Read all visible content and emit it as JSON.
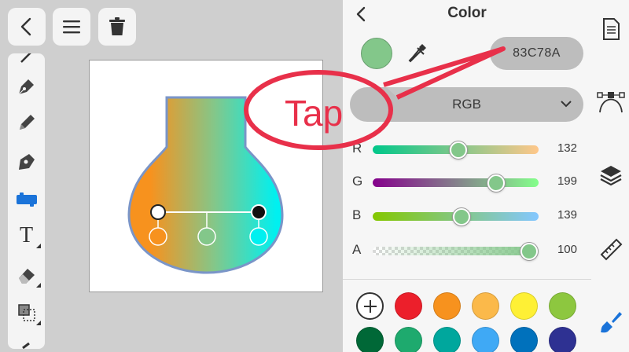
{
  "toolbar": {
    "back": "back-arrow-icon",
    "menu": "hamburger-menu-icon",
    "delete": "trash-icon"
  },
  "tools": [
    "pen-nib-icon",
    "pencil-icon",
    "shape-pen-icon",
    "ruler-tool-icon",
    "text-tool-icon",
    "eraser-icon",
    "transform-icon"
  ],
  "text_tool_label": "T",
  "panel": {
    "title": "Color",
    "hex_value": "83C78A",
    "mode": "RGB",
    "current_color": "#83C78A",
    "sliders": [
      {
        "label": "R",
        "value": "132"
      },
      {
        "label": "G",
        "value": "199"
      },
      {
        "label": "B",
        "value": "139"
      },
      {
        "label": "A",
        "value": "100"
      }
    ],
    "palette": [
      "#ec1f2b",
      "#f7921e",
      "#fbb94a",
      "#fef035",
      "#8dc73f",
      "#006837",
      "#1eaa6e",
      "#00a79d",
      "#3fa9f5",
      "#0071bc",
      "#2e3192"
    ]
  },
  "rail_icons": [
    "document-icon",
    "bezier-icon",
    "layers-icon",
    "ruler-icon",
    "brush-icon"
  ],
  "callout": {
    "text": "Tap"
  },
  "accent_color": "#1a73d9"
}
